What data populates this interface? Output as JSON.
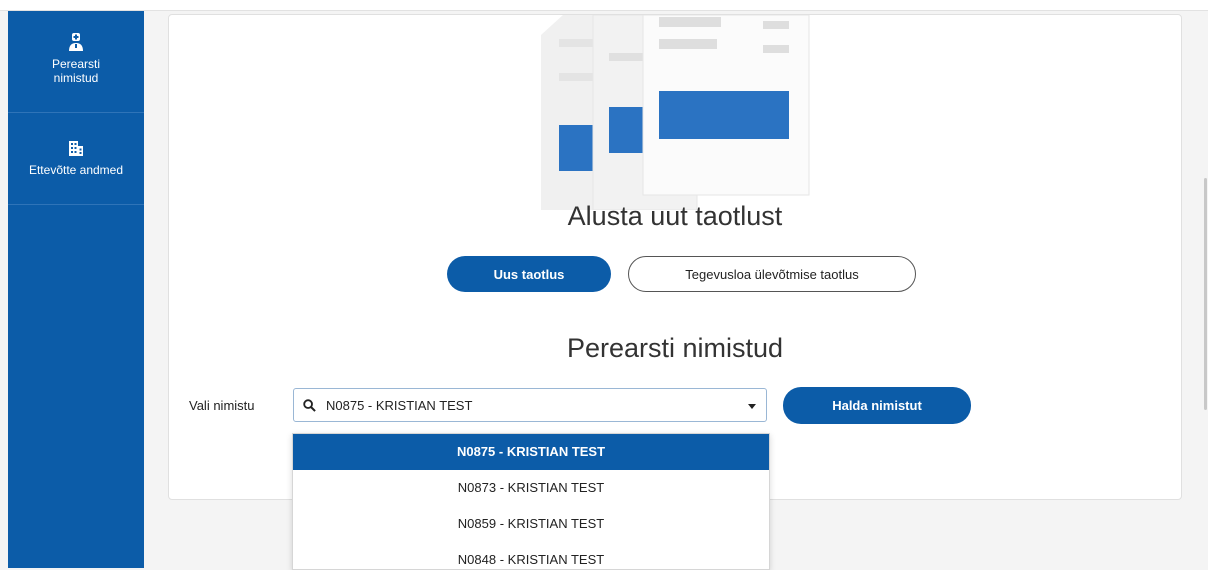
{
  "sidebar": {
    "items": [
      {
        "label_line1": "Perearsti",
        "label_line2": "nimistud",
        "icon": "doctor-icon"
      },
      {
        "label": "Ettevõtte andmed",
        "icon": "building-icon"
      }
    ]
  },
  "main": {
    "new_application_title": "Alusta uut taotlust",
    "new_application_button": "Uus taotlus",
    "takeover_button": "Tegevusloa ülevõtmise taotlus",
    "lists_title": "Perearsti nimistud",
    "select_label": "Vali nimistu",
    "select_value": "N0875 - KRISTIAN TEST",
    "manage_button": "Halda nimistut"
  },
  "dropdown": {
    "options": [
      "N0875 - KRISTIAN TEST",
      "N0873 - KRISTIAN TEST",
      "N0859 - KRISTIAN TEST",
      "N0848 - KRISTIAN TEST"
    ],
    "selected_index": 0
  },
  "colors": {
    "primary": "#0c5ca8",
    "illustration_blue": "#2b73c2",
    "page_bg": "#f4f4f4"
  }
}
